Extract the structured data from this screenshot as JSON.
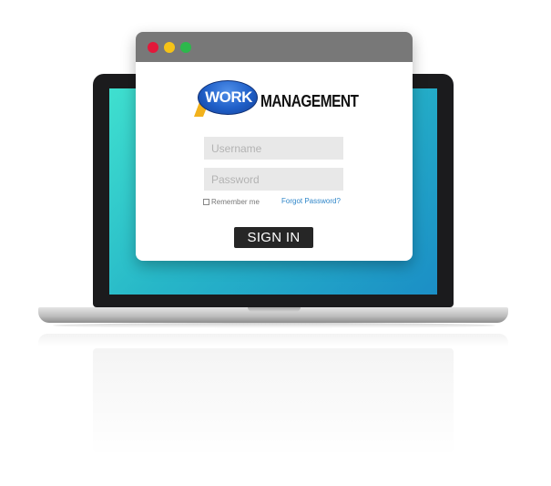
{
  "logo": {
    "brand_word": "WORK",
    "brand_rest": "MANAGEMENT"
  },
  "form": {
    "username_placeholder": "Username",
    "password_placeholder": "Password",
    "remember_label": "Remember me",
    "forgot_label": "Forgot Password?",
    "signin_label": "SIGN IN"
  },
  "window_controls": {
    "close_color": "#e3183a",
    "minimize_color": "#f5c317",
    "maximize_color": "#2db84c"
  },
  "colors": {
    "screen_gradient": [
      "#3fe0cf",
      "#1b8ec6"
    ],
    "button_bg": "#262626",
    "link": "#2f86c9",
    "logo_blue": "#1f5fc8"
  }
}
